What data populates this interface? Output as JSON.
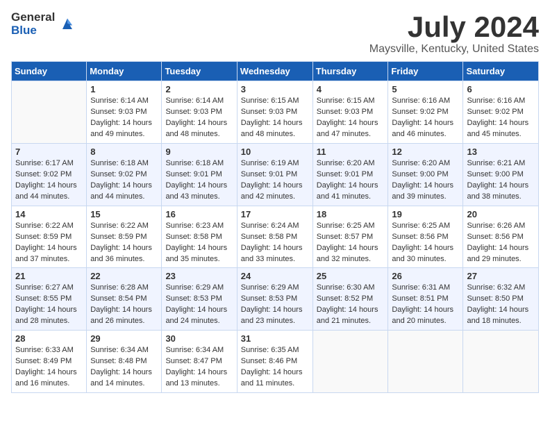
{
  "logo": {
    "general": "General",
    "blue": "Blue"
  },
  "title": "July 2024",
  "subtitle": "Maysville, Kentucky, United States",
  "days_of_week": [
    "Sunday",
    "Monday",
    "Tuesday",
    "Wednesday",
    "Thursday",
    "Friday",
    "Saturday"
  ],
  "weeks": [
    [
      {
        "day": "",
        "info": ""
      },
      {
        "day": "1",
        "info": "Sunrise: 6:14 AM\nSunset: 9:03 PM\nDaylight: 14 hours and 49 minutes."
      },
      {
        "day": "2",
        "info": "Sunrise: 6:14 AM\nSunset: 9:03 PM\nDaylight: 14 hours and 48 minutes."
      },
      {
        "day": "3",
        "info": "Sunrise: 6:15 AM\nSunset: 9:03 PM\nDaylight: 14 hours and 48 minutes."
      },
      {
        "day": "4",
        "info": "Sunrise: 6:15 AM\nSunset: 9:03 PM\nDaylight: 14 hours and 47 minutes."
      },
      {
        "day": "5",
        "info": "Sunrise: 6:16 AM\nSunset: 9:02 PM\nDaylight: 14 hours and 46 minutes."
      },
      {
        "day": "6",
        "info": "Sunrise: 6:16 AM\nSunset: 9:02 PM\nDaylight: 14 hours and 45 minutes."
      }
    ],
    [
      {
        "day": "7",
        "info": "Sunrise: 6:17 AM\nSunset: 9:02 PM\nDaylight: 14 hours and 44 minutes."
      },
      {
        "day": "8",
        "info": "Sunrise: 6:18 AM\nSunset: 9:02 PM\nDaylight: 14 hours and 44 minutes."
      },
      {
        "day": "9",
        "info": "Sunrise: 6:18 AM\nSunset: 9:01 PM\nDaylight: 14 hours and 43 minutes."
      },
      {
        "day": "10",
        "info": "Sunrise: 6:19 AM\nSunset: 9:01 PM\nDaylight: 14 hours and 42 minutes."
      },
      {
        "day": "11",
        "info": "Sunrise: 6:20 AM\nSunset: 9:01 PM\nDaylight: 14 hours and 41 minutes."
      },
      {
        "day": "12",
        "info": "Sunrise: 6:20 AM\nSunset: 9:00 PM\nDaylight: 14 hours and 39 minutes."
      },
      {
        "day": "13",
        "info": "Sunrise: 6:21 AM\nSunset: 9:00 PM\nDaylight: 14 hours and 38 minutes."
      }
    ],
    [
      {
        "day": "14",
        "info": "Sunrise: 6:22 AM\nSunset: 8:59 PM\nDaylight: 14 hours and 37 minutes."
      },
      {
        "day": "15",
        "info": "Sunrise: 6:22 AM\nSunset: 8:59 PM\nDaylight: 14 hours and 36 minutes."
      },
      {
        "day": "16",
        "info": "Sunrise: 6:23 AM\nSunset: 8:58 PM\nDaylight: 14 hours and 35 minutes."
      },
      {
        "day": "17",
        "info": "Sunrise: 6:24 AM\nSunset: 8:58 PM\nDaylight: 14 hours and 33 minutes."
      },
      {
        "day": "18",
        "info": "Sunrise: 6:25 AM\nSunset: 8:57 PM\nDaylight: 14 hours and 32 minutes."
      },
      {
        "day": "19",
        "info": "Sunrise: 6:25 AM\nSunset: 8:56 PM\nDaylight: 14 hours and 30 minutes."
      },
      {
        "day": "20",
        "info": "Sunrise: 6:26 AM\nSunset: 8:56 PM\nDaylight: 14 hours and 29 minutes."
      }
    ],
    [
      {
        "day": "21",
        "info": "Sunrise: 6:27 AM\nSunset: 8:55 PM\nDaylight: 14 hours and 28 minutes."
      },
      {
        "day": "22",
        "info": "Sunrise: 6:28 AM\nSunset: 8:54 PM\nDaylight: 14 hours and 26 minutes."
      },
      {
        "day": "23",
        "info": "Sunrise: 6:29 AM\nSunset: 8:53 PM\nDaylight: 14 hours and 24 minutes."
      },
      {
        "day": "24",
        "info": "Sunrise: 6:29 AM\nSunset: 8:53 PM\nDaylight: 14 hours and 23 minutes."
      },
      {
        "day": "25",
        "info": "Sunrise: 6:30 AM\nSunset: 8:52 PM\nDaylight: 14 hours and 21 minutes."
      },
      {
        "day": "26",
        "info": "Sunrise: 6:31 AM\nSunset: 8:51 PM\nDaylight: 14 hours and 20 minutes."
      },
      {
        "day": "27",
        "info": "Sunrise: 6:32 AM\nSunset: 8:50 PM\nDaylight: 14 hours and 18 minutes."
      }
    ],
    [
      {
        "day": "28",
        "info": "Sunrise: 6:33 AM\nSunset: 8:49 PM\nDaylight: 14 hours and 16 minutes."
      },
      {
        "day": "29",
        "info": "Sunrise: 6:34 AM\nSunset: 8:48 PM\nDaylight: 14 hours and 14 minutes."
      },
      {
        "day": "30",
        "info": "Sunrise: 6:34 AM\nSunset: 8:47 PM\nDaylight: 14 hours and 13 minutes."
      },
      {
        "day": "31",
        "info": "Sunrise: 6:35 AM\nSunset: 8:46 PM\nDaylight: 14 hours and 11 minutes."
      },
      {
        "day": "",
        "info": ""
      },
      {
        "day": "",
        "info": ""
      },
      {
        "day": "",
        "info": ""
      }
    ]
  ]
}
